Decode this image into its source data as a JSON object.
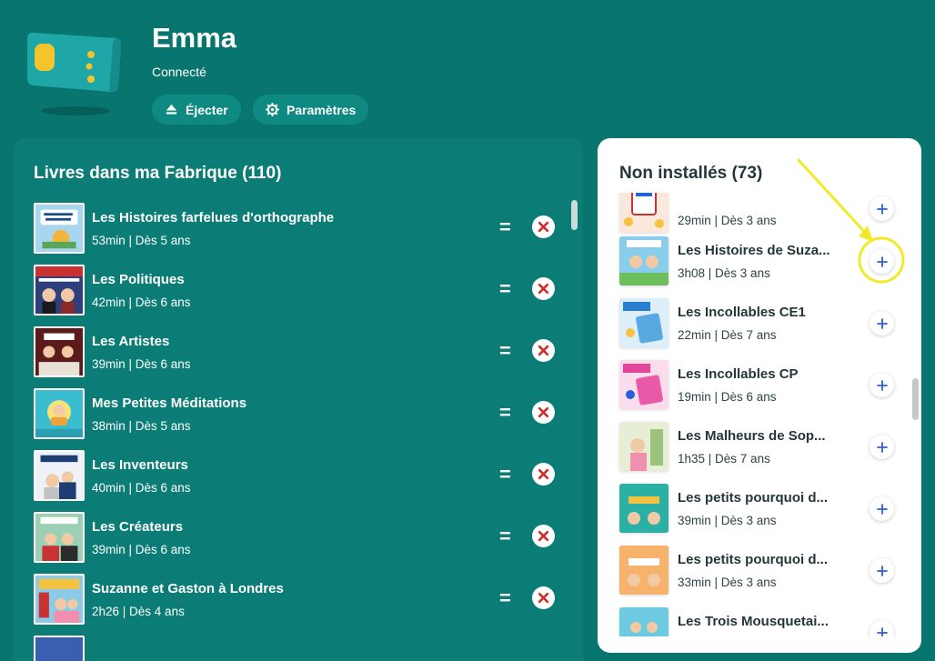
{
  "header": {
    "device_name": "Emma",
    "status": "Connecté",
    "eject_label": "Éjecter",
    "settings_label": "Paramètres"
  },
  "installed": {
    "title": "Livres dans ma Fabrique (110)",
    "books": [
      {
        "title": "Les Histoires farfelues d'orthographe",
        "meta": "53min | Dès 5 ans",
        "cover_color": "#6bb0d8"
      },
      {
        "title": "Les Politiques",
        "meta": "42min | Dès 6 ans",
        "cover_color": "#3b4c8a"
      },
      {
        "title": "Les Artistes",
        "meta": "39min | Dès 6 ans",
        "cover_color": "#6a1e1e"
      },
      {
        "title": "Mes Petites Méditations",
        "meta": "38min | Dès 5 ans",
        "cover_color": "#38b6c9"
      },
      {
        "title": "Les Inventeurs",
        "meta": "40min | Dès 6 ans",
        "cover_color": "#e9eef3"
      },
      {
        "title": "Les Créateurs",
        "meta": "39min | Dès 6 ans",
        "cover_color": "#8ac6a8"
      },
      {
        "title": "Suzanne et Gaston à Londres",
        "meta": "2h26 | Dès 4 ans",
        "cover_color": "#f4c23e"
      }
    ]
  },
  "not_installed": {
    "title": "Non installés (73)",
    "books": [
      {
        "title": "",
        "meta": "29min | Dès 3 ans",
        "cover_color": "#f3d7c9"
      },
      {
        "title": "Les Histoires de Suza...",
        "meta": "3h08 | Dès 3 ans",
        "cover_color": "#7cc6e6"
      },
      {
        "title": "Les Incollables CE1",
        "meta": "22min | Dès 7 ans",
        "cover_color": "#5aa8e0"
      },
      {
        "title": "Les Incollables CP",
        "meta": "19min | Dès 6 ans",
        "cover_color": "#e85aa7"
      },
      {
        "title": "Les Malheurs de Sop...",
        "meta": "1h35 | Dès 7 ans",
        "cover_color": "#bcd7a4"
      },
      {
        "title": "Les petits pourquoi d...",
        "meta": "39min | Dès 3 ans",
        "cover_color": "#28a9a0"
      },
      {
        "title": "Les petits pourquoi d...",
        "meta": "33min | Dès 3 ans",
        "cover_color": "#f08b3a"
      },
      {
        "title": "Les Trois Mousquetai...",
        "meta": "",
        "cover_color": "#5fc0d9"
      }
    ]
  },
  "colors": {
    "background": "#08766f",
    "panel": "#0b7d76",
    "remove_icon": "#c9302c",
    "add_icon": "#2b5fd9",
    "annotation": "#f2e92a"
  },
  "icons": {
    "eject": "eject-icon",
    "settings": "gear-icon",
    "drag": "drag-handle-icon",
    "remove": "close-icon",
    "add": "plus-icon"
  }
}
